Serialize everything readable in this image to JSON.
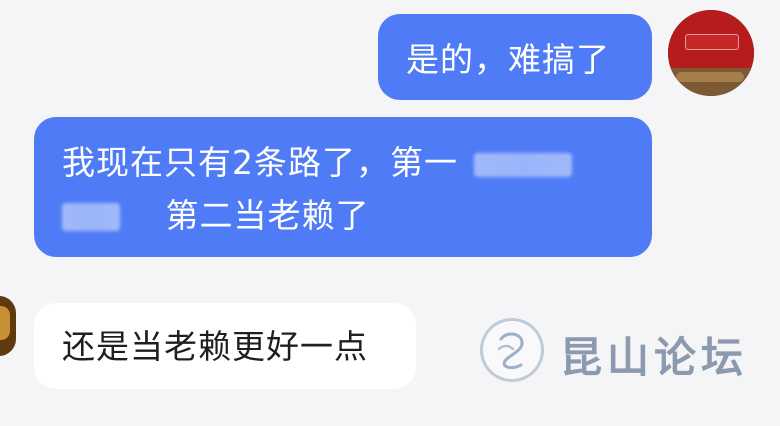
{
  "messages": [
    {
      "side": "right",
      "text": "是的，难搞了"
    },
    {
      "side": "right",
      "line1_prefix": "我现在只有2条路了，第一",
      "line2_suffix": "第二当老赖了"
    },
    {
      "side": "left",
      "text": "还是当老赖更好一点"
    }
  ],
  "watermark": {
    "brand": "昆山论坛"
  },
  "colors": {
    "background": "#f5f5f7",
    "outgoing_bubble": "#4f7cf6",
    "incoming_bubble": "#ffffff"
  },
  "icons": {
    "watermark_logo": "brand-logo-icon"
  }
}
